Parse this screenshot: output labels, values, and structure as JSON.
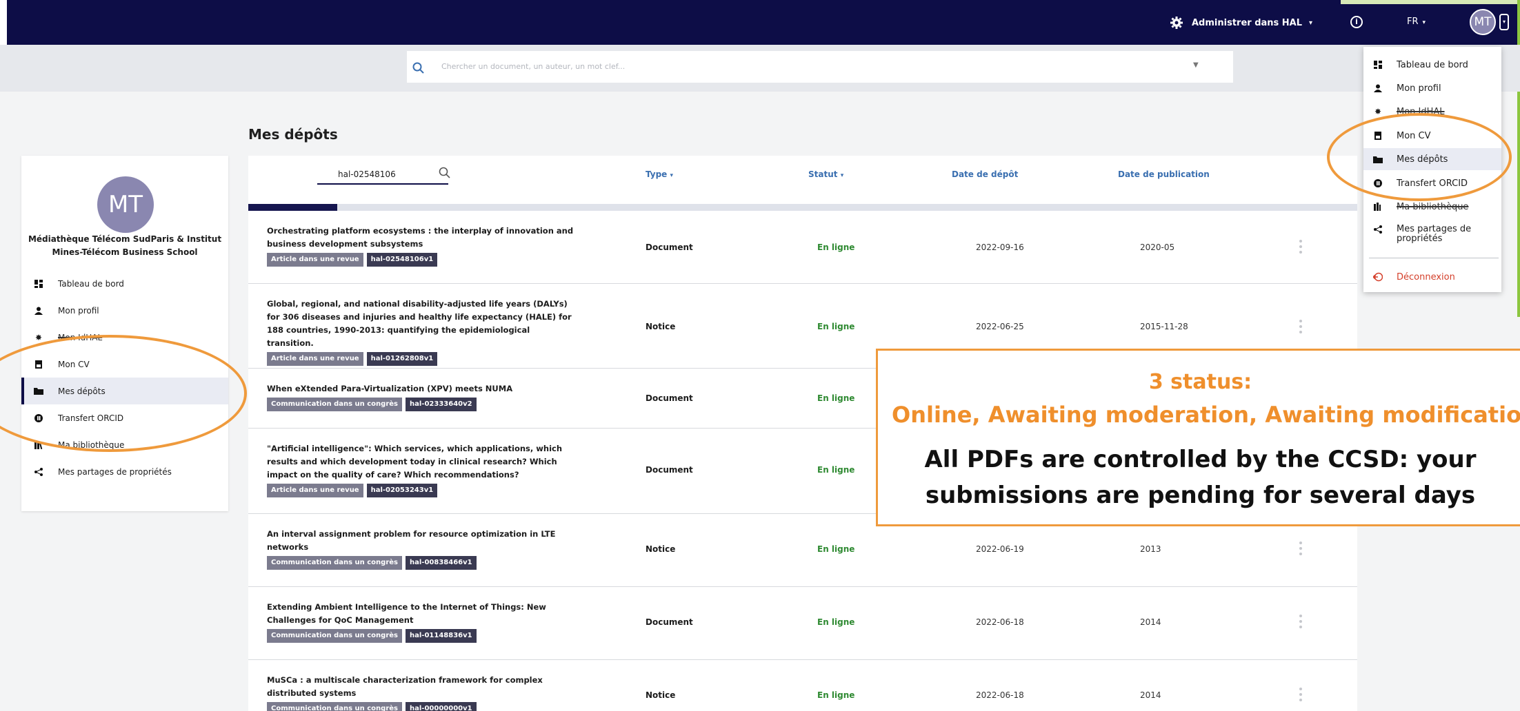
{
  "header": {
    "admin_label": "Administrer dans HAL",
    "lang": "FR",
    "avatar_initials": "MT"
  },
  "search": {
    "placeholder": "Chercher un document, un auteur, un mot clef..."
  },
  "page": {
    "title": "Mes dépôts"
  },
  "profile": {
    "initials": "MT",
    "name": "Médiathèque Télécom SudParis & Institut Mines-Télécom Business School"
  },
  "sidebar": {
    "items": [
      {
        "label": "Tableau de bord",
        "icon": "dashboard-icon"
      },
      {
        "label": "Mon profil",
        "icon": "user-icon"
      },
      {
        "label": "Mon IdHAL",
        "icon": "idhal-icon"
      },
      {
        "label": "Mon CV",
        "icon": "cv-icon"
      },
      {
        "label": "Mes dépôts",
        "icon": "folder-icon"
      },
      {
        "label": "Transfert ORCID",
        "icon": "orcid-icon"
      },
      {
        "label": "Ma bibliothèque",
        "icon": "library-icon"
      },
      {
        "label": "Mes partages de propriétés",
        "icon": "share-icon"
      }
    ]
  },
  "table": {
    "search_value": "hal-02548106",
    "headers": {
      "type": "Type",
      "status": "Statut",
      "deposit": "Date de dépôt",
      "publication": "Date de publication"
    },
    "progress": 0.08,
    "rows": [
      {
        "title": "Orchestrating platform ecosystems : the interplay of innovation and business development subsystems",
        "kind": "Article dans une revue",
        "id": "hal-02548106v1",
        "type": "Document",
        "status": "En ligne",
        "deposit": "2022-09-16",
        "publication": "2020-05"
      },
      {
        "title": "Global, regional, and national disability-adjusted life years (DALYs) for 306 diseases and injuries and healthy life expectancy (HALE) for 188 countries, 1990-2013: quantifying the epidemiological transition.",
        "kind": "Article dans une revue",
        "id": "hal-01262808v1",
        "type": "Notice",
        "status": "En ligne",
        "deposit": "2022-06-25",
        "publication": "2015-11-28"
      },
      {
        "title": "When eXtended Para-Virtualization (XPV) meets NUMA",
        "kind": "Communication dans un congrès",
        "id": "hal-02333640v2",
        "type": "Document",
        "status": "En ligne",
        "deposit": "",
        "publication": ""
      },
      {
        "title": "\"Artificial intelligence\": Which services, which applications, which results and which development today in clinical research? Which impact on the quality of care? Which recommendations?",
        "kind": "Article dans une revue",
        "id": "hal-02053243v1",
        "type": "Document",
        "status": "En ligne",
        "deposit": "",
        "publication": ""
      },
      {
        "title": "An interval assignment problem for resource optimization in LTE networks",
        "kind": "Communication dans un congrès",
        "id": "hal-00838466v1",
        "type": "Notice",
        "status": "En ligne",
        "deposit": "2022-06-19",
        "publication": "2013"
      },
      {
        "title": "Extending Ambient Intelligence to the Internet of Things: New Challenges for QoC Management",
        "kind": "Communication dans un congrès",
        "id": "hal-01148836v1",
        "type": "Document",
        "status": "En ligne",
        "deposit": "2022-06-18",
        "publication": "2014"
      },
      {
        "title": "MuSCa : a multiscale characterization framework for complex distributed systems",
        "kind": "Communication dans un congrès",
        "id": "hal-00000000v1",
        "type": "Notice",
        "status": "En ligne",
        "deposit": "2022-06-18",
        "publication": "2014"
      }
    ]
  },
  "menu": {
    "items": [
      {
        "label": "Tableau de bord"
      },
      {
        "label": "Mon profil"
      },
      {
        "label": "Mon IdHAL"
      },
      {
        "label": "Mon CV"
      },
      {
        "label": "Mes dépôts"
      },
      {
        "label": "Transfert ORCID"
      },
      {
        "label": "Ma bibliothèque"
      },
      {
        "label": "Mes partages de propriétés"
      }
    ],
    "logout": "Déconnexion"
  },
  "callout": {
    "line1": "3 status:",
    "line2": "Online, Awaiting moderation, Awaiting modification",
    "line3": "All PDFs are controlled by the CCSD: your submissions are pending for several days"
  },
  "colors": {
    "navy": "#0d0d47",
    "accent_orange": "#ef9a3c",
    "status_green": "#2f8a32",
    "link_blue": "#3a6fb0"
  }
}
